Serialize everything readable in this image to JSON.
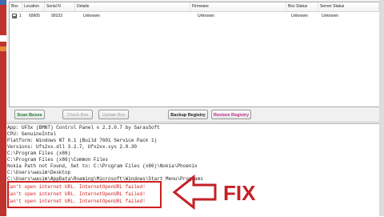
{
  "colors": {
    "accent_red": "#c42026",
    "scan_green": "#1d7a2f",
    "restore_magenta": "#c0288e",
    "disabled_gray": "#a0a0a0"
  },
  "grid": {
    "columns": [
      "Box",
      "Location",
      "Serial N",
      "Details",
      "Firmware",
      "Box Status",
      "Server Status"
    ],
    "rows": [
      {
        "index": "1",
        "checked": true,
        "location": "69905",
        "serial": "99103",
        "details": "Unknown",
        "firmware": "Unknown",
        "box_status": "Unknown",
        "server_status": "Unknown"
      }
    ]
  },
  "buttons": {
    "scan": "Scan Boxes",
    "check": "Check Box",
    "update": "Update Box",
    "backup": "Backup Registry",
    "restore": "Restore Registry"
  },
  "log": {
    "lines": [
      "App: UFSx (BMNT) Control Panel v 2.3.0.7 by SarasSoft",
      "CPU: GenuineIntel",
      "Platform: Windows NT 6.1 (Build 7601 Service Pack 1)",
      "Versions: Ufs2xx.dll 3.2.7, Ufx2xx.sys 2.0.30",
      "C:\\Program Files (x86)",
      "C:\\Program Files (x86)\\Common Files",
      "Nokia Path not Found, Set to: C:\\Program Files (x86)\\Nokia\\Phoenix",
      "C:\\Users\\wasim\\Desktop",
      "C:\\Users\\wasim\\AppData\\Roaming\\Microsoft\\Windows\\Start Menu\\Programs"
    ],
    "errors": [
      "Can't open internet URL. InternetOpenURL failed!",
      "Can't open internet URL. InternetOpenURL failed!",
      "Can't open internet URL. InternetOpenURL failed!"
    ]
  },
  "annotation": {
    "label": "FIX",
    "arrow_icon": "left-arrow-icon"
  }
}
